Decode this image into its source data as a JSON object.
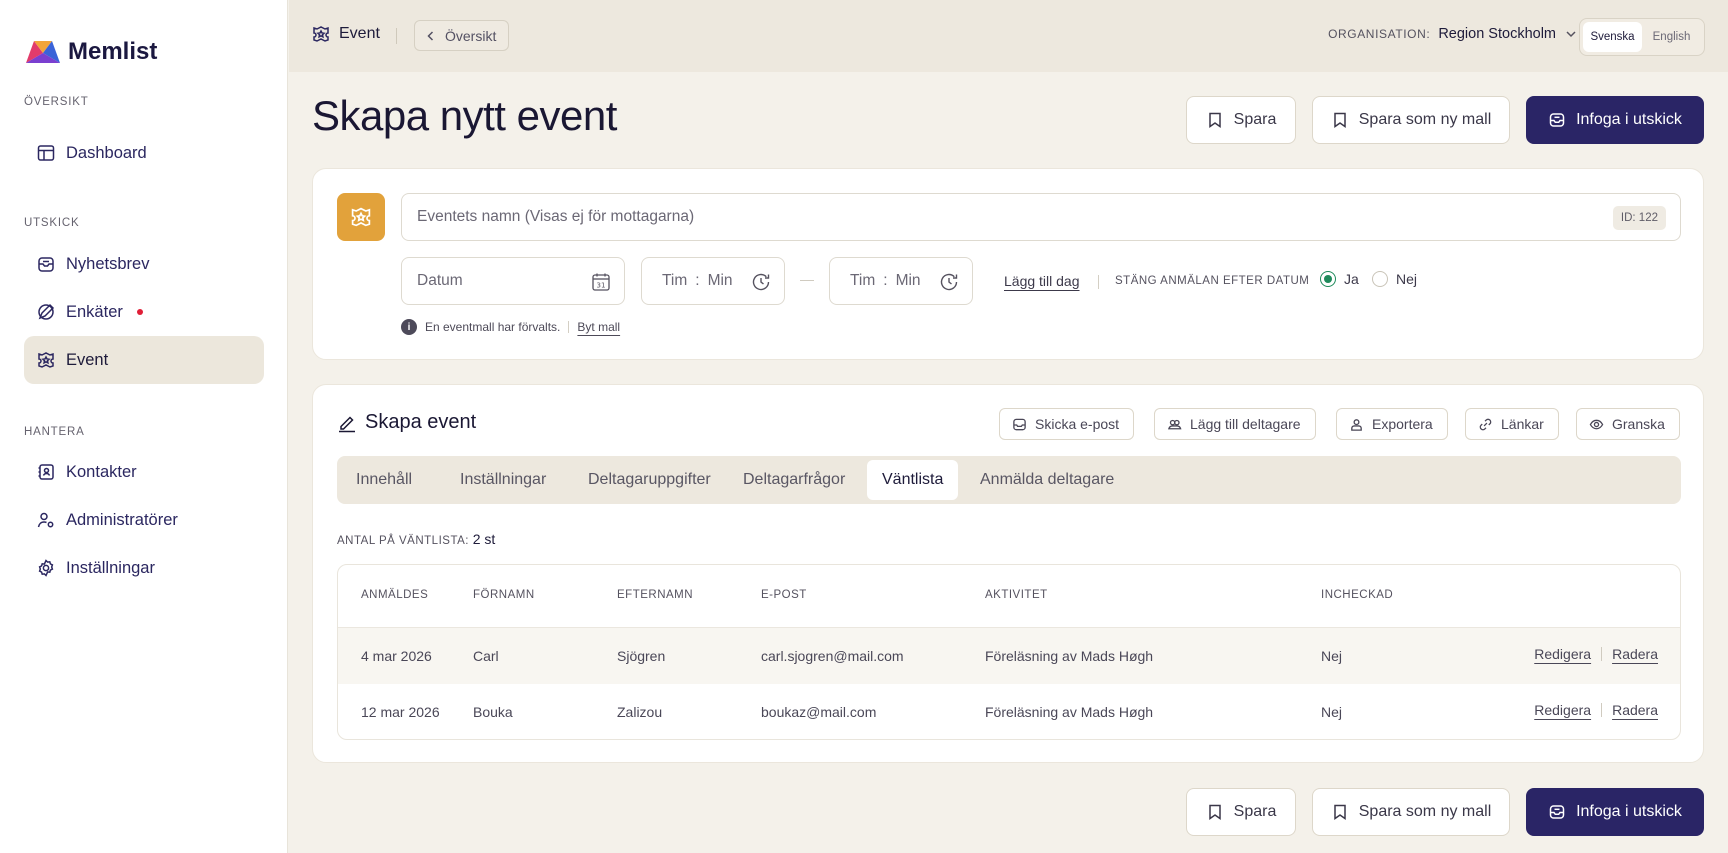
{
  "app": {
    "name": "Memlist"
  },
  "sidebar": {
    "sections": [
      {
        "title": "ÖVERSIKT",
        "items": [
          {
            "label": "Dashboard"
          }
        ]
      },
      {
        "title": "UTSKICK",
        "items": [
          {
            "label": "Nyhetsbrev"
          },
          {
            "label": "Enkäter"
          },
          {
            "label": "Event"
          }
        ]
      },
      {
        "title": "HANTERA",
        "items": [
          {
            "label": "Kontakter"
          },
          {
            "label": "Administratörer"
          },
          {
            "label": "Inställningar"
          }
        ]
      }
    ],
    "active_item": "Event"
  },
  "topbar": {
    "section": "Event",
    "back_label": "Översikt",
    "org_label": "ORGANISATION:",
    "org_value": "Region Stockholm",
    "languages": [
      "Svenska",
      "English"
    ],
    "active_language": "Svenska"
  },
  "page": {
    "title": "Skapa nytt event",
    "actions": {
      "save": "Spara",
      "save_template": "Spara som ny mall",
      "insert": "Infoga i utskick"
    }
  },
  "event_form": {
    "name_placeholder": "Eventets namn  (Visas ej för mottagarna)",
    "id_badge": "ID: 122",
    "date_placeholder": "Datum",
    "calendar_day": "31",
    "time_start": {
      "hour": "Tim",
      "sep": ":",
      "minute": "Min"
    },
    "time_end": {
      "hour": "Tim",
      "sep": ":",
      "minute": "Min"
    },
    "add_day": "Lägg till dag",
    "close_after_label": "STÄNG ANMÄLAN EFTER DATUM",
    "options": [
      {
        "label": "Ja",
        "selected": true
      },
      {
        "label": "Nej",
        "selected": false
      }
    ],
    "info_text": "En eventmall har förvalts.",
    "change_template": "Byt mall"
  },
  "editor": {
    "title": "Skapa event",
    "actions": [
      {
        "label": "Skicka e-post",
        "icon": "mail-icon"
      },
      {
        "label": "Lägg till deltagare",
        "icon": "add-people-icon"
      },
      {
        "label": "Exportera",
        "icon": "export-icon"
      },
      {
        "label": "Länkar",
        "icon": "link-icon"
      },
      {
        "label": "Granska",
        "icon": "eye-icon"
      }
    ],
    "tabs": [
      "Innehåll",
      "Inställningar",
      "Deltagaruppgifter",
      "Deltagarfrågor",
      "Väntlista",
      "Anmälda deltagare"
    ],
    "active_tab": "Väntlista",
    "waitlist_label": "ANTAL PÅ VÄNTLISTA:",
    "waitlist_count": "2 st",
    "table": {
      "columns": [
        "ANMÄLDES",
        "FÖRNAMN",
        "EFTERNAMN",
        "E-POST",
        "AKTIVITET",
        "INCHECKAD"
      ],
      "rows": [
        {
          "registered": "4 mar 2026",
          "first": "Carl",
          "last": "Sjögren",
          "email": "carl.sjogren@mail.com",
          "activity": "Föreläsning av Mads Høgh",
          "checked_in": "Nej",
          "edit": "Redigera",
          "delete": "Radera"
        },
        {
          "registered": "12 mar 2026",
          "first": "Bouka",
          "last": "Zalizou",
          "email": "boukaz@mail.com",
          "activity": "Föreläsning av Mads Høgh",
          "checked_in": "Nej",
          "edit": "Redigera",
          "delete": "Radera"
        }
      ]
    }
  },
  "colors": {
    "primary": "#2a2566",
    "accent": "#e2a23b",
    "success": "#1f8a5b",
    "alert": "#e01e37",
    "background": "#f4f1ea"
  }
}
